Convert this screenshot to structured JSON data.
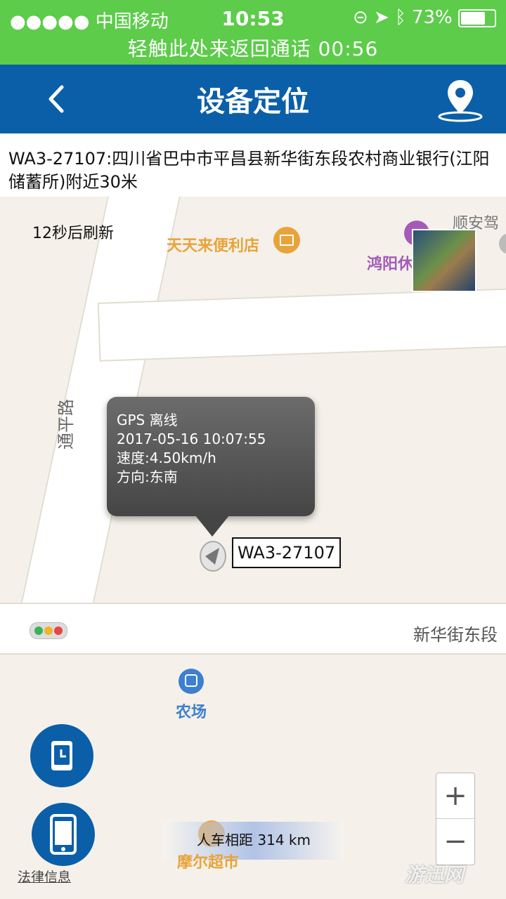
{
  "status_bar": {
    "carrier": "●●●●● 中国移动",
    "time": "10:53",
    "battery": "73%",
    "call_banner": "轻触此处来返回通话  00:56"
  },
  "nav": {
    "title": "设备定位",
    "back_icon": "chevron-left-icon",
    "location_icon": "location-pin-icon"
  },
  "address": "WA3-27107:四川省巴中市平昌县新华街东段农村商业银行(江阳储蓄所)附近30米",
  "map": {
    "refresh_text": "12秒后刷新",
    "pois": {
      "store": "天天来便利店",
      "shunan": "顺安驾",
      "hongyang": "鸿阳休",
      "street": "通平路",
      "xinhua": "新华街东段",
      "bus": "农场",
      "supermarket": "摩尔超市"
    },
    "popup": {
      "line1": "GPS 离线",
      "line2": "2017-05-16 10:07:55",
      "line3": "速度:4.50km/h",
      "line4": "方向:东南"
    },
    "device_label": "WA3-27107",
    "distance": "人车相距 314 km",
    "zoom_in": "+",
    "zoom_out": "−",
    "legal": "法律信息",
    "watermark": "游迅网"
  },
  "colors": {
    "status_green": "#5ccc4a",
    "nav_blue": "#0a5fa8",
    "poi_orange": "#e8a33a",
    "poi_purple": "#a45bb8",
    "poi_blue": "#3d7fd1"
  }
}
